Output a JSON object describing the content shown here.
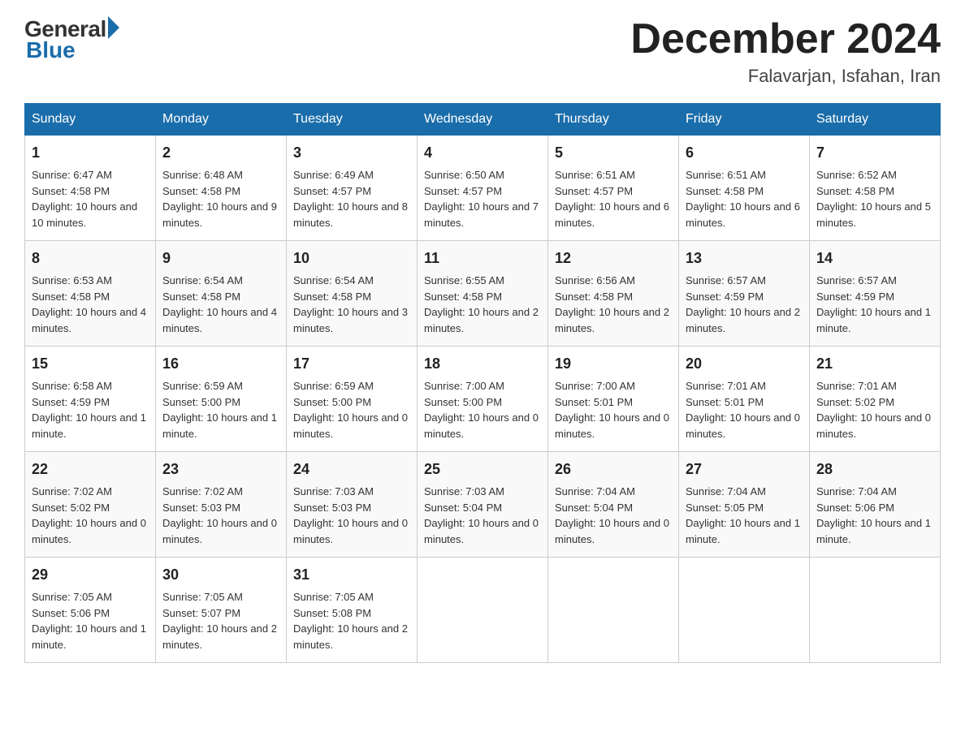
{
  "logo": {
    "general": "General",
    "blue": "Blue"
  },
  "title": "December 2024",
  "location": "Falavarjan, Isfahan, Iran",
  "days_of_week": [
    "Sunday",
    "Monday",
    "Tuesday",
    "Wednesday",
    "Thursday",
    "Friday",
    "Saturday"
  ],
  "weeks": [
    [
      {
        "day": "1",
        "sunrise": "6:47 AM",
        "sunset": "4:58 PM",
        "daylight": "10 hours and 10 minutes."
      },
      {
        "day": "2",
        "sunrise": "6:48 AM",
        "sunset": "4:58 PM",
        "daylight": "10 hours and 9 minutes."
      },
      {
        "day": "3",
        "sunrise": "6:49 AM",
        "sunset": "4:57 PM",
        "daylight": "10 hours and 8 minutes."
      },
      {
        "day": "4",
        "sunrise": "6:50 AM",
        "sunset": "4:57 PM",
        "daylight": "10 hours and 7 minutes."
      },
      {
        "day": "5",
        "sunrise": "6:51 AM",
        "sunset": "4:57 PM",
        "daylight": "10 hours and 6 minutes."
      },
      {
        "day": "6",
        "sunrise": "6:51 AM",
        "sunset": "4:58 PM",
        "daylight": "10 hours and 6 minutes."
      },
      {
        "day": "7",
        "sunrise": "6:52 AM",
        "sunset": "4:58 PM",
        "daylight": "10 hours and 5 minutes."
      }
    ],
    [
      {
        "day": "8",
        "sunrise": "6:53 AM",
        "sunset": "4:58 PM",
        "daylight": "10 hours and 4 minutes."
      },
      {
        "day": "9",
        "sunrise": "6:54 AM",
        "sunset": "4:58 PM",
        "daylight": "10 hours and 4 minutes."
      },
      {
        "day": "10",
        "sunrise": "6:54 AM",
        "sunset": "4:58 PM",
        "daylight": "10 hours and 3 minutes."
      },
      {
        "day": "11",
        "sunrise": "6:55 AM",
        "sunset": "4:58 PM",
        "daylight": "10 hours and 2 minutes."
      },
      {
        "day": "12",
        "sunrise": "6:56 AM",
        "sunset": "4:58 PM",
        "daylight": "10 hours and 2 minutes."
      },
      {
        "day": "13",
        "sunrise": "6:57 AM",
        "sunset": "4:59 PM",
        "daylight": "10 hours and 2 minutes."
      },
      {
        "day": "14",
        "sunrise": "6:57 AM",
        "sunset": "4:59 PM",
        "daylight": "10 hours and 1 minute."
      }
    ],
    [
      {
        "day": "15",
        "sunrise": "6:58 AM",
        "sunset": "4:59 PM",
        "daylight": "10 hours and 1 minute."
      },
      {
        "day": "16",
        "sunrise": "6:59 AM",
        "sunset": "5:00 PM",
        "daylight": "10 hours and 1 minute."
      },
      {
        "day": "17",
        "sunrise": "6:59 AM",
        "sunset": "5:00 PM",
        "daylight": "10 hours and 0 minutes."
      },
      {
        "day": "18",
        "sunrise": "7:00 AM",
        "sunset": "5:00 PM",
        "daylight": "10 hours and 0 minutes."
      },
      {
        "day": "19",
        "sunrise": "7:00 AM",
        "sunset": "5:01 PM",
        "daylight": "10 hours and 0 minutes."
      },
      {
        "day": "20",
        "sunrise": "7:01 AM",
        "sunset": "5:01 PM",
        "daylight": "10 hours and 0 minutes."
      },
      {
        "day": "21",
        "sunrise": "7:01 AM",
        "sunset": "5:02 PM",
        "daylight": "10 hours and 0 minutes."
      }
    ],
    [
      {
        "day": "22",
        "sunrise": "7:02 AM",
        "sunset": "5:02 PM",
        "daylight": "10 hours and 0 minutes."
      },
      {
        "day": "23",
        "sunrise": "7:02 AM",
        "sunset": "5:03 PM",
        "daylight": "10 hours and 0 minutes."
      },
      {
        "day": "24",
        "sunrise": "7:03 AM",
        "sunset": "5:03 PM",
        "daylight": "10 hours and 0 minutes."
      },
      {
        "day": "25",
        "sunrise": "7:03 AM",
        "sunset": "5:04 PM",
        "daylight": "10 hours and 0 minutes."
      },
      {
        "day": "26",
        "sunrise": "7:04 AM",
        "sunset": "5:04 PM",
        "daylight": "10 hours and 0 minutes."
      },
      {
        "day": "27",
        "sunrise": "7:04 AM",
        "sunset": "5:05 PM",
        "daylight": "10 hours and 1 minute."
      },
      {
        "day": "28",
        "sunrise": "7:04 AM",
        "sunset": "5:06 PM",
        "daylight": "10 hours and 1 minute."
      }
    ],
    [
      {
        "day": "29",
        "sunrise": "7:05 AM",
        "sunset": "5:06 PM",
        "daylight": "10 hours and 1 minute."
      },
      {
        "day": "30",
        "sunrise": "7:05 AM",
        "sunset": "5:07 PM",
        "daylight": "10 hours and 2 minutes."
      },
      {
        "day": "31",
        "sunrise": "7:05 AM",
        "sunset": "5:08 PM",
        "daylight": "10 hours and 2 minutes."
      },
      null,
      null,
      null,
      null
    ]
  ],
  "labels": {
    "sunrise": "Sunrise:",
    "sunset": "Sunset:",
    "daylight": "Daylight:"
  }
}
